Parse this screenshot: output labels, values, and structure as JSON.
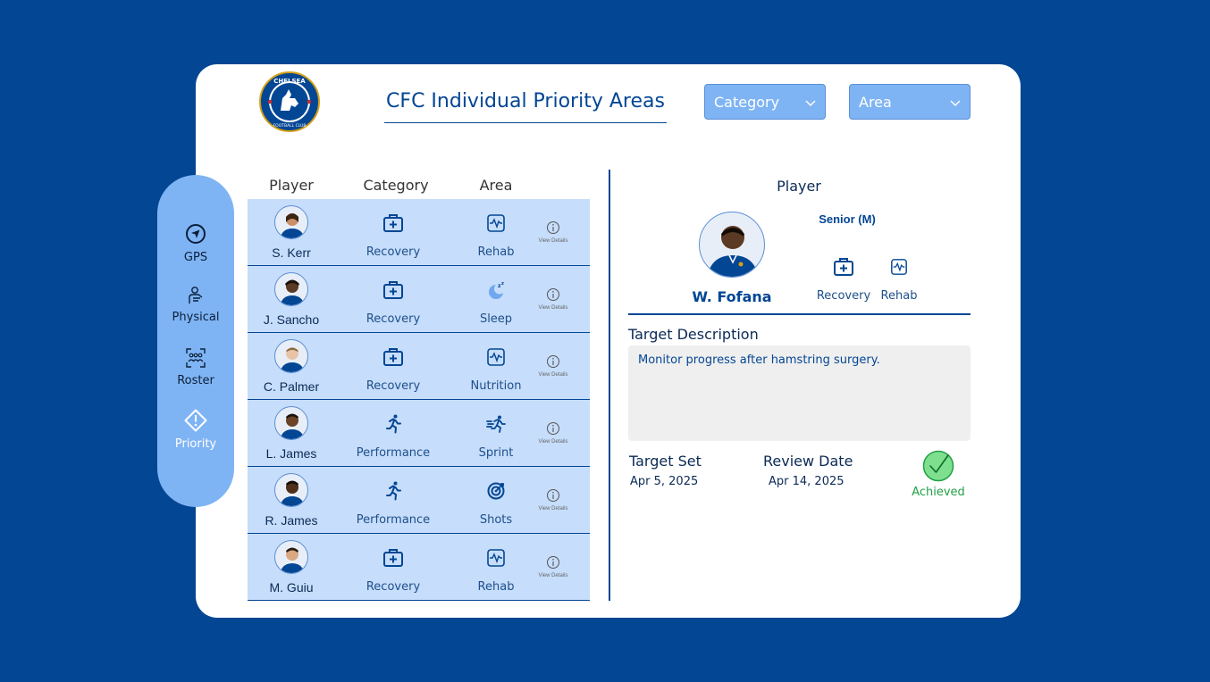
{
  "header": {
    "title": "CFC Individual Priority Areas",
    "crest_text_top": "CHELSEA",
    "crest_text_bottom": "FOOTBALL CLUB"
  },
  "filters": {
    "category": "Category",
    "area": "Area"
  },
  "sidebar": {
    "items": [
      {
        "label": "GPS",
        "icon": "navigation-icon"
      },
      {
        "label": "Physical",
        "icon": "physical-icon"
      },
      {
        "label": "Roster",
        "icon": "roster-icon"
      },
      {
        "label": "Priority",
        "icon": "priority-icon",
        "active": true
      }
    ]
  },
  "table": {
    "headers": [
      "Player",
      "Category",
      "Area"
    ],
    "details_label": "View Details",
    "rows": [
      {
        "player": "S. Kerr",
        "category": "Recovery",
        "area": "Rehab",
        "category_icon": "first-aid-icon",
        "area_icon": "activity-icon"
      },
      {
        "player": "J. Sancho",
        "category": "Recovery",
        "area": "Sleep",
        "category_icon": "first-aid-icon",
        "area_icon": "sleep-icon"
      },
      {
        "player": "C. Palmer",
        "category": "Recovery",
        "area": "Nutrition",
        "category_icon": "first-aid-icon",
        "area_icon": "activity-icon"
      },
      {
        "player": "L. James",
        "category": "Performance",
        "area": "Sprint",
        "category_icon": "running-icon",
        "area_icon": "sprint-icon"
      },
      {
        "player": "R. James",
        "category": "Performance",
        "area": "Shots",
        "category_icon": "running-icon",
        "area_icon": "target-icon"
      },
      {
        "player": "M. Guiu",
        "category": "Recovery",
        "area": "Rehab",
        "category_icon": "first-aid-icon",
        "area_icon": "activity-icon"
      }
    ]
  },
  "detail": {
    "heading": "Player",
    "name": "W. Fofana",
    "level": "Senior (M)",
    "category": "Recovery",
    "area": "Rehab",
    "target_description_label": "Target Description",
    "target_description": "Monitor progress after hamstring surgery.",
    "target_set_label": "Target Set",
    "target_set": "Apr 5, 2025",
    "review_date_label": "Review Date",
    "review_date": "Apr 14, 2025",
    "status": "Achieved"
  },
  "colors": {
    "background": "#034694",
    "sidebar": "#7fb4f4",
    "row": "#c6ddfb",
    "achieved": "#22a045"
  }
}
